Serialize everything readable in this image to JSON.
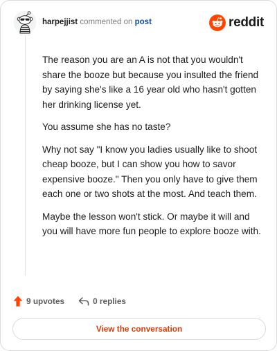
{
  "header": {
    "username": "harpejjist",
    "action_text": "commented on",
    "post_link": "post",
    "brand_name": "reddit",
    "brand_color": "#ff4500"
  },
  "comment": {
    "paragraphs": [
      "The reason you are an A is not that you wouldn't share the booze but because you insulted the friend by saying she's like a 16 year old who hasn't gotten her drinking license yet.",
      "You assume she has no taste?",
      "Why not say \"I know you ladies usually like to shoot cheap booze, but I can show you how to savor expensive booze.\" Then you only have to give them each one or two shots at the most. And teach them.",
      "Maybe the lesson won't stick. Or maybe it will and you will have more fun people to explore booze with."
    ]
  },
  "actions": {
    "upvotes_label": "9 upvotes",
    "replies_label": "0 replies",
    "upvote_icon": "upvote-arrow-icon",
    "reply_icon": "reply-arrow-icon",
    "upvote_color": "#ff4500"
  },
  "footer": {
    "view_button_label": "View the conversation",
    "accent_color": "#d63b07"
  }
}
